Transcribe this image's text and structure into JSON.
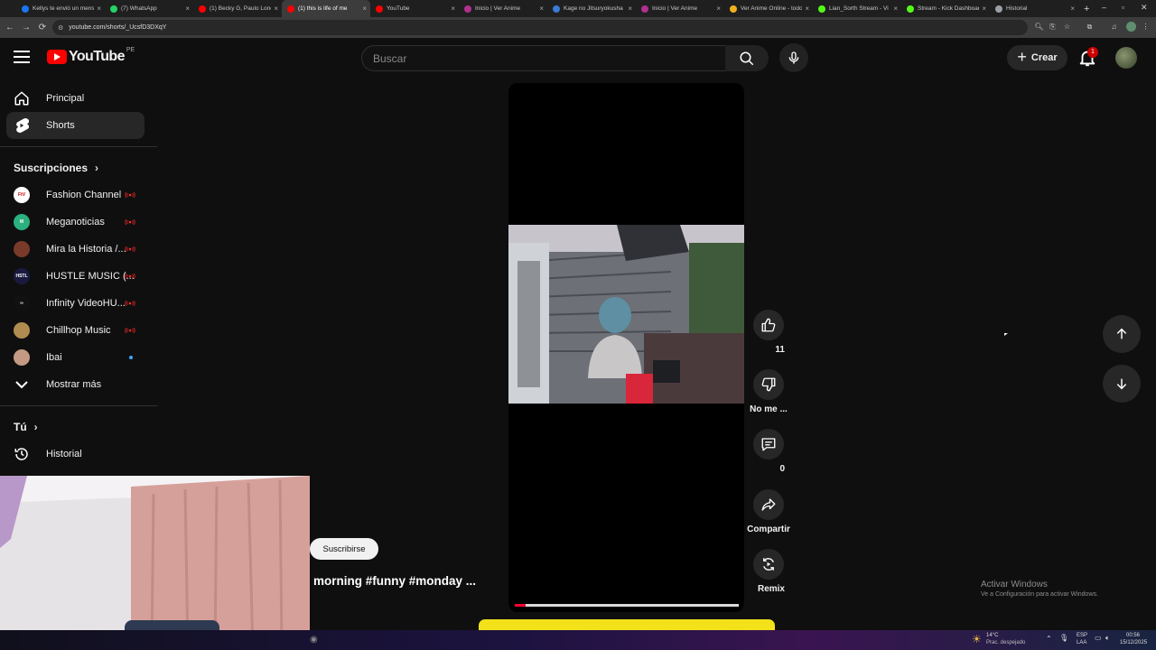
{
  "browser": {
    "tabs": [
      {
        "title": "Kellys te envió un mensaje",
        "favicon_color": "#1877f2",
        "active": false
      },
      {
        "title": "(7) WhatsApp",
        "favicon_color": "#25d366",
        "active": false
      },
      {
        "title": "(1) Becky G, Paulo Londra",
        "favicon_color": "#ff0000",
        "active": false
      },
      {
        "title": "(1) this is life of me",
        "favicon_color": "#ff0000",
        "active": true
      },
      {
        "title": "YouTube",
        "favicon_color": "#ff0000",
        "active": false
      },
      {
        "title": "Inicio | Ver Anime",
        "favicon_color": "#b03090",
        "active": false
      },
      {
        "title": "Kage no Jitsuryokusha",
        "favicon_color": "#3a7bd5",
        "active": false
      },
      {
        "title": "Inicio | Ver Anime",
        "favicon_color": "#b03090",
        "active": false
      },
      {
        "title": "Ver Anime Online - todos",
        "favicon_color": "#f2b01e",
        "active": false
      },
      {
        "title": "Lian_Sorth Stream - Vi",
        "favicon_color": "#53fc18",
        "active": false
      },
      {
        "title": "Stream - Kick Dashboard",
        "favicon_color": "#53fc18",
        "active": false
      },
      {
        "title": "Historial",
        "favicon_color": "#9aa0a6",
        "active": false
      }
    ],
    "url": "youtube.com/shorts/_UcsfD3DXqY",
    "colors": {
      "tabstrip": "#1f1f1f",
      "toolbar": "#3c3c3c"
    }
  },
  "header": {
    "logo_text": "YouTube",
    "country_code": "PE",
    "search_placeholder": "Buscar",
    "create_label": "Crear",
    "notification_count": "1"
  },
  "sidebar": {
    "main": [
      {
        "label": "Principal",
        "icon": "home-icon",
        "active": false
      },
      {
        "label": "Shorts",
        "icon": "shorts-icon",
        "active": true
      }
    ],
    "subscriptions_title": "Suscripciones",
    "subscriptions": [
      {
        "label": "Fashion Channel",
        "avatar_color": "#ffffff",
        "avatar_text": "FtV",
        "status": "live"
      },
      {
        "label": "Meganoticias",
        "avatar_color": "#2bb07f",
        "avatar_text": "M",
        "status": "live"
      },
      {
        "label": "Mira la Historia /...",
        "avatar_color": "#7a3a2a",
        "avatar_text": "",
        "status": "live"
      },
      {
        "label": "HUSTLE MUSIC (...",
        "avatar_color": "#1a1a40",
        "avatar_text": "HSTL",
        "status": "live"
      },
      {
        "label": "Infinity VideoHU...",
        "avatar_color": "#111111",
        "avatar_text": "∞",
        "status": "live"
      },
      {
        "label": "Chillhop Music",
        "avatar_color": "#b08c50",
        "avatar_text": "",
        "status": "live"
      },
      {
        "label": "Ibai",
        "avatar_color": "#c49a84",
        "avatar_text": "",
        "status": "new"
      }
    ],
    "show_more_label": "Mostrar más",
    "you_title": "Tú",
    "history_label": "Historial"
  },
  "short": {
    "subscribe_label": "Suscribirse",
    "caption": "morning #funny #monday ...",
    "progress": 0.05
  },
  "actions": {
    "like_count": "11",
    "dislike_label": "No me ...",
    "comment_count": "0",
    "share_label": "Compartir",
    "remix_label": "Remix"
  },
  "watermark": {
    "line1": "Activar Windows",
    "line2": "Ve a Configuración para activar Windows."
  },
  "taskbar": {
    "weather_temp": "14°C",
    "weather_desc": "Prac. despejado",
    "lang_top": "ESP",
    "lang_bottom": "LAA",
    "time": "00:56",
    "date": "15/12/2025"
  }
}
